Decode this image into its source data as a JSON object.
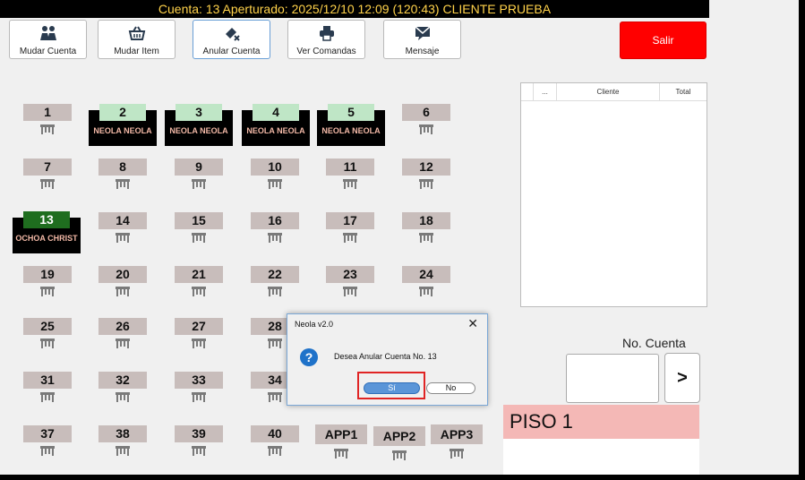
{
  "header": {
    "title": "Cuenta: 13   Aperturado: 2025/12/10 12:09  (120:43)  CLIENTE PRUEBA"
  },
  "toolbar": {
    "mudar_cuenta": "Mudar Cuenta",
    "mudar_item": "Mudar Item",
    "anular_cuenta": "Anular Cuenta",
    "ver_comandas": "Ver Comandas",
    "mensaje": "Mensaje",
    "salir": "Salir"
  },
  "tables": {
    "t1": "1",
    "t2": "2",
    "t3": "3",
    "t4": "4",
    "t5": "5",
    "t6": "6",
    "t7": "7",
    "t8": "8",
    "t9": "9",
    "t10": "10",
    "t11": "11",
    "t12": "12",
    "t13": "13",
    "t14": "14",
    "t15": "15",
    "t16": "16",
    "t17": "17",
    "t18": "18",
    "t19": "19",
    "t20": "20",
    "t21": "21",
    "t22": "22",
    "t23": "23",
    "t24": "24",
    "t25": "25",
    "t26": "26",
    "t27": "27",
    "t28": "28",
    "t31": "31",
    "t32": "32",
    "t33": "33",
    "t34": "34",
    "t37": "37",
    "t38": "38",
    "t39": "39",
    "t40": "40",
    "app1": "APP1",
    "app2": "APP2",
    "app3": "APP3"
  },
  "occupied": {
    "t2_name": "NEOLA NEOLA",
    "t3_name": "NEOLA NEOLA",
    "t4_name": "NEOLA NEOLA",
    "t5_name": "NEOLA NEOLA",
    "t13_name": "OCHOA CHRIST"
  },
  "accounts_table": {
    "col_dots": "...",
    "col_cliente": "Cliente",
    "col_total": "Total"
  },
  "account_panel": {
    "label": "No. Cuenta",
    "go": ">",
    "floor": "PISO 1"
  },
  "dialog": {
    "title": "Neola v2.0",
    "close": "✕",
    "icon": "?",
    "message": "Desea Anular Cuenta No. 13",
    "yes": "Sí",
    "no": "No"
  },
  "colors": {
    "salir": "#ff0000",
    "header_text": "#ffd24a",
    "occupied_number": "#bfe6c6",
    "current_number": "#1f6d1f",
    "floor_bar": "#f4b8b6"
  }
}
